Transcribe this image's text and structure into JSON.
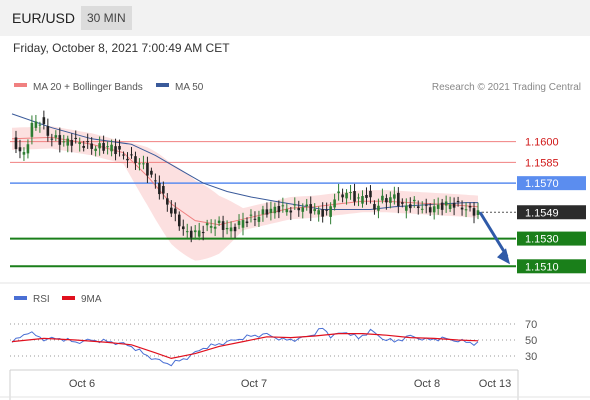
{
  "header": {
    "symbol": "EUR/USD",
    "timeframe": "30 MIN",
    "datetime": "Friday, October 8, 2021 7:00:49 AM CET"
  },
  "colors": {
    "ma20": "#f08080",
    "ma50": "#3a5a9a",
    "up": "#2e7d32",
    "down": "#222222",
    "resistance": "#f08080",
    "pivot": "#5b8def",
    "support": "#1a7f1a",
    "arrow": "#2f5aa8",
    "rsi": "#4a6fd4",
    "rsi_ma": "#e0101e"
  },
  "chart_data": [
    {
      "type": "candlestick",
      "title": "EUR/USD",
      "legend": [
        "MA 20 + Bollinger Bands",
        "MA 50"
      ],
      "source": "Research © 2021 Trading Central",
      "x_ticks": [
        "Oct 6",
        "Oct 7",
        "Oct 8",
        "Oct 13"
      ],
      "ylim": [
        1.1503,
        1.163
      ],
      "last_price": 1.1549,
      "levels": [
        {
          "value": 1.16,
          "label": "1.1600",
          "kind": "resistance"
        },
        {
          "value": 1.1585,
          "label": "1.1585",
          "kind": "resistance"
        },
        {
          "value": 1.157,
          "label": "1.1570",
          "kind": "pivot"
        },
        {
          "value": 1.1549,
          "label": "1.1549",
          "kind": "last"
        },
        {
          "value": 1.153,
          "label": "1.1530",
          "kind": "support"
        },
        {
          "value": 1.151,
          "label": "1.1510",
          "kind": "support"
        }
      ],
      "forecast_arrow": {
        "from": 1.1549,
        "to": 1.151
      },
      "close_path": [
        [
          0,
          1.16
        ],
        [
          3,
          1.159
        ],
        [
          5,
          1.1612
        ],
        [
          7,
          1.1615
        ],
        [
          9,
          1.1605
        ],
        [
          12,
          1.16
        ],
        [
          16,
          1.16
        ],
        [
          20,
          1.1596
        ],
        [
          25,
          1.1596
        ],
        [
          28,
          1.159
        ],
        [
          32,
          1.1585
        ],
        [
          35,
          1.1575
        ],
        [
          38,
          1.156
        ],
        [
          41,
          1.1545
        ],
        [
          44,
          1.1533
        ],
        [
          47,
          1.1535
        ],
        [
          50,
          1.154
        ],
        [
          52,
          1.154
        ],
        [
          55,
          1.1536
        ],
        [
          58,
          1.1543
        ],
        [
          61,
          1.1545
        ],
        [
          64,
          1.155
        ],
        [
          67,
          1.1552
        ],
        [
          70,
          1.1551
        ],
        [
          73,
          1.1553
        ],
        [
          76,
          1.155
        ],
        [
          79,
          1.1548
        ],
        [
          81,
          1.156
        ],
        [
          84,
          1.1563
        ],
        [
          87,
          1.1558
        ],
        [
          89,
          1.1562
        ],
        [
          91,
          1.1552
        ],
        [
          93,
          1.1558
        ],
        [
          96,
          1.156
        ],
        [
          98,
          1.1553
        ],
        [
          101,
          1.1555
        ],
        [
          104,
          1.1551
        ],
        [
          107,
          1.1553
        ],
        [
          110,
          1.1555
        ],
        [
          113,
          1.1553
        ],
        [
          115,
          1.155
        ],
        [
          117,
          1.1549
        ]
      ],
      "ma20_path": [
        [
          0,
          1.1602
        ],
        [
          10,
          1.1603
        ],
        [
          20,
          1.1598
        ],
        [
          28,
          1.1592
        ],
        [
          34,
          1.1575
        ],
        [
          40,
          1.1555
        ],
        [
          46,
          1.1543
        ],
        [
          52,
          1.154
        ],
        [
          58,
          1.1544
        ],
        [
          64,
          1.1548
        ],
        [
          70,
          1.1552
        ],
        [
          76,
          1.1553
        ],
        [
          82,
          1.1555
        ],
        [
          88,
          1.1557
        ],
        [
          94,
          1.1557
        ],
        [
          100,
          1.1556
        ],
        [
          106,
          1.1555
        ],
        [
          112,
          1.1554
        ],
        [
          117,
          1.1553
        ]
      ],
      "ma50_path": [
        [
          0,
          1.162
        ],
        [
          10,
          1.161
        ],
        [
          20,
          1.1602
        ],
        [
          30,
          1.1598
        ],
        [
          36,
          1.159
        ],
        [
          42,
          1.158
        ],
        [
          48,
          1.157
        ],
        [
          54,
          1.1564
        ],
        [
          60,
          1.156
        ],
        [
          66,
          1.1557
        ],
        [
          72,
          1.1554
        ],
        [
          78,
          1.1551
        ],
        [
          84,
          1.1551
        ],
        [
          90,
          1.1551
        ],
        [
          96,
          1.1553
        ],
        [
          102,
          1.1554
        ],
        [
          108,
          1.1555
        ],
        [
          114,
          1.1556
        ],
        [
          117,
          1.1556
        ]
      ]
    },
    {
      "type": "line",
      "title": "RSI",
      "legend": [
        "RSI",
        "9MA"
      ],
      "y_ticks": [
        "70",
        "50",
        "30"
      ],
      "ylim": [
        15,
        85
      ],
      "rsi_path": [
        [
          0,
          47
        ],
        [
          4,
          60
        ],
        [
          8,
          51
        ],
        [
          12,
          52
        ],
        [
          16,
          47
        ],
        [
          20,
          50
        ],
        [
          24,
          48
        ],
        [
          28,
          45
        ],
        [
          30,
          42
        ],
        [
          34,
          30
        ],
        [
          38,
          22
        ],
        [
          40,
          20
        ],
        [
          44,
          28
        ],
        [
          48,
          40
        ],
        [
          52,
          45
        ],
        [
          56,
          50
        ],
        [
          60,
          55
        ],
        [
          64,
          57
        ],
        [
          68,
          50
        ],
        [
          72,
          51
        ],
        [
          76,
          58
        ],
        [
          78,
          65
        ],
        [
          80,
          55
        ],
        [
          84,
          60
        ],
        [
          87,
          52
        ],
        [
          90,
          62
        ],
        [
          93,
          52
        ],
        [
          96,
          48
        ],
        [
          100,
          55
        ],
        [
          104,
          50
        ],
        [
          108,
          52
        ],
        [
          112,
          49
        ],
        [
          116,
          46
        ]
      ],
      "ma9_path": [
        [
          0,
          48
        ],
        [
          8,
          52
        ],
        [
          16,
          50
        ],
        [
          24,
          47
        ],
        [
          30,
          44
        ],
        [
          36,
          34
        ],
        [
          40,
          27
        ],
        [
          46,
          33
        ],
        [
          52,
          42
        ],
        [
          58,
          48
        ],
        [
          64,
          54
        ],
        [
          70,
          53
        ],
        [
          76,
          55
        ],
        [
          82,
          58
        ],
        [
          88,
          58
        ],
        [
          94,
          56
        ],
        [
          100,
          53
        ],
        [
          106,
          52
        ],
        [
          112,
          50
        ],
        [
          117,
          49
        ]
      ]
    }
  ]
}
